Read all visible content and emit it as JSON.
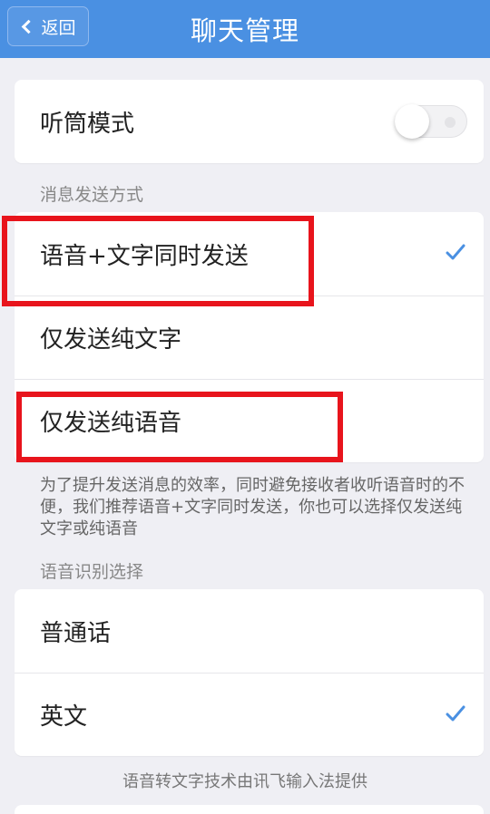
{
  "nav": {
    "back_label": "返回",
    "title": "聊天管理"
  },
  "earpiece": {
    "label": "听筒模式",
    "enabled": false
  },
  "send_mode": {
    "section_label": "消息发送方式",
    "options": [
      {
        "label": "语音+文字同时发送",
        "selected": true
      },
      {
        "label": "仅发送纯文字",
        "selected": false
      },
      {
        "label": "仅发送纯语音",
        "selected": false
      }
    ],
    "note": "为了提升发送消息的效率，同时避免接收者收听语音时的不便，我们推荐语音+文字同时发送，你也可以选择仅发送纯文字或纯语音"
  },
  "recognition": {
    "section_label": "语音识别选择",
    "options": [
      {
        "label": "普通话",
        "selected": false
      },
      {
        "label": "英文",
        "selected": true
      }
    ],
    "footer": "语音转文字技术由讯飞输入法提供"
  },
  "colors": {
    "accent": "#4a90e2",
    "highlight": "#e8141c"
  }
}
